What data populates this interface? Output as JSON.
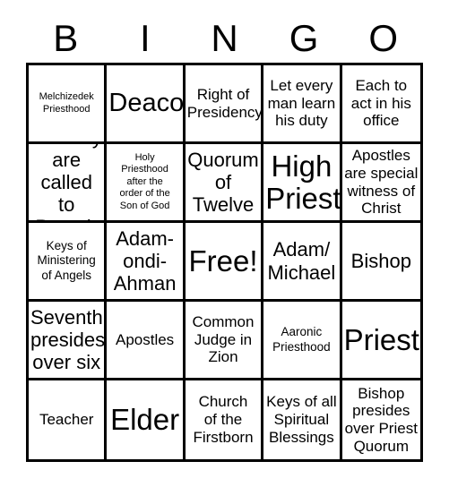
{
  "card": {
    "title": "BINGO",
    "header_letters": [
      "B",
      "I",
      "N",
      "G",
      "O"
    ],
    "free_space_label": "Free!",
    "colors": {
      "background": "#ffffff",
      "cell_background": "#ffffff",
      "border": "#000000",
      "text": "#000000"
    },
    "grid_size": "5x5",
    "rows": [
      [
        {
          "text": "Melchizedek\nPriesthood",
          "size": "xs"
        },
        {
          "text": "Deacon",
          "size": "xl"
        },
        {
          "text": "Right of\nPresidency",
          "size": "m"
        },
        {
          "text": "Let every\nman learn\nhis duty",
          "size": "m"
        },
        {
          "text": "Each to\nact in his\noffice",
          "size": "m"
        }
      ],
      [
        {
          "text": "Seventy\nare called\nto Preach",
          "size": "l"
        },
        {
          "text": "Holy\nPriesthood\nafter the\norder of the\nSon of God",
          "size": "xs"
        },
        {
          "text": "Quorum\nof\nTwelve",
          "size": "l"
        },
        {
          "text": "High\nPriest",
          "size": "xxl"
        },
        {
          "text": "Apostles\nare special\nwitness of\nChrist",
          "size": "m"
        }
      ],
      [
        {
          "text": "Keys of\nMinistering\nof Angels",
          "size": "s"
        },
        {
          "text": "Adam-\nondi-\nAhman",
          "size": "l"
        },
        {
          "text": "Free!",
          "size": "xxl"
        },
        {
          "text": "Adam/\nMichael",
          "size": "l"
        },
        {
          "text": "Bishop",
          "size": "l"
        }
      ],
      [
        {
          "text": "Seventh\npresides\nover six",
          "size": "l"
        },
        {
          "text": "Apostles",
          "size": "m"
        },
        {
          "text": "Common\nJudge in\nZion",
          "size": "m"
        },
        {
          "text": "Aaronic\nPriesthood",
          "size": "s"
        },
        {
          "text": "Priest",
          "size": "xxl"
        }
      ],
      [
        {
          "text": "Teacher",
          "size": "m"
        },
        {
          "text": "Elder",
          "size": "xxl"
        },
        {
          "text": "Church\nof the\nFirstborn",
          "size": "m"
        },
        {
          "text": "Keys of all\nSpiritual\nBlessings",
          "size": "m"
        },
        {
          "text": "Bishop\npresides\nover Priest\nQuorum",
          "size": "m"
        }
      ]
    ]
  }
}
